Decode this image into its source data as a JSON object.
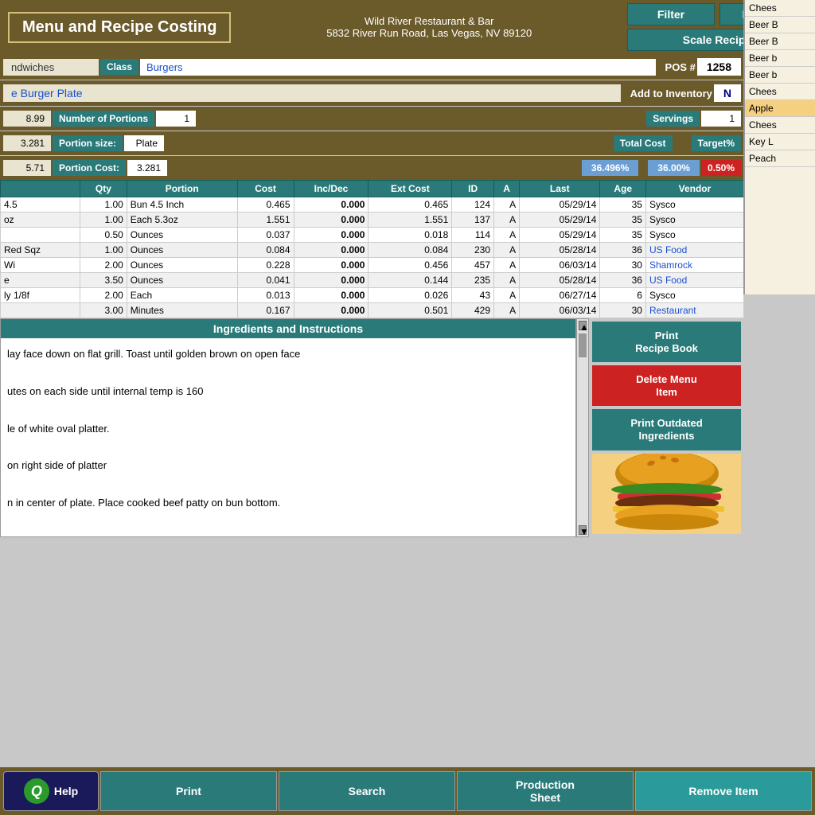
{
  "header": {
    "title": "Menu  and  Recipe  Costing",
    "restaurant_name": "Wild River Restaurant & Bar",
    "address": "5832 River Run Road, Las Vegas, NV 89120",
    "filter_label": "Filter",
    "release_label": "Release",
    "scale_recipe_label": "Scale Recipe"
  },
  "sidebar_items": [
    {
      "label": "Chees",
      "highlighted": false
    },
    {
      "label": "Beer B",
      "highlighted": false
    },
    {
      "label": "Beer B",
      "highlighted": false
    },
    {
      "label": "Beer b",
      "highlighted": false
    },
    {
      "label": "Beer b",
      "highlighted": false
    },
    {
      "label": "Chees",
      "highlighted": false
    },
    {
      "label": "Apple",
      "highlighted": true
    },
    {
      "label": "Chees",
      "highlighted": false
    },
    {
      "label": "Key L",
      "highlighted": false
    },
    {
      "label": "Peach",
      "highlighted": false
    }
  ],
  "form": {
    "category": "ndwiches",
    "class_label": "Class",
    "class_value": "Burgers",
    "pos_label": "POS #",
    "pos_value": "1258",
    "item_name": "e Burger Plate",
    "add_inventory_label": "Add to Inventory",
    "inventory_value": "N",
    "price": "8.99",
    "portions_label": "Number of Portions",
    "portions_value": "1",
    "servings_label": "Servings",
    "servings_value": "1",
    "portion_val_left": "3.281",
    "portion_size_label": "Portion size:",
    "portion_size_value": "Plate",
    "total_cost_label": "Total Cost",
    "target_label": "Target%",
    "price_left": "5.71",
    "portion_cost_label": "Portion Cost:",
    "portion_cost_value": "3.281",
    "total_cost_pct": "36.496%",
    "target_pct": "36.00%",
    "variance_pct": "0.50%"
  },
  "table": {
    "columns": [
      "Qty",
      "Portion",
      "Cost",
      "Inc/Dec",
      "Ext Cost",
      "ID",
      "A",
      "Last",
      "Age",
      "Vendor"
    ],
    "rows": [
      {
        "name": "4.5",
        "qty": "1.00",
        "portion": "Bun 4.5 Inch",
        "cost": "0.465",
        "incdec": "0.000",
        "extcost": "0.465",
        "id": "124",
        "a": "A",
        "last": "05/29/14",
        "age": "35",
        "vendor": "Sysco"
      },
      {
        "name": "oz",
        "qty": "1.00",
        "portion": "Each 5.3oz",
        "cost": "1.551",
        "incdec": "0.000",
        "extcost": "1.551",
        "id": "137",
        "a": "A",
        "last": "05/29/14",
        "age": "35",
        "vendor": "Sysco"
      },
      {
        "name": "",
        "qty": "0.50",
        "portion": "Ounces",
        "cost": "0.037",
        "incdec": "0.000",
        "extcost": "0.018",
        "id": "114",
        "a": "A",
        "last": "05/29/14",
        "age": "35",
        "vendor": "Sysco"
      },
      {
        "name": "Red Sqz",
        "qty": "1.00",
        "portion": "Ounces",
        "cost": "0.084",
        "incdec": "0.000",
        "extcost": "0.084",
        "id": "230",
        "a": "A",
        "last": "05/28/14",
        "age": "36",
        "vendor": "US Food"
      },
      {
        "name": "Wi",
        "qty": "2.00",
        "portion": "Ounces",
        "cost": "0.228",
        "incdec": "0.000",
        "extcost": "0.456",
        "id": "457",
        "a": "A",
        "last": "06/03/14",
        "age": "30",
        "vendor": "Shamrock"
      },
      {
        "name": "e",
        "qty": "3.50",
        "portion": "Ounces",
        "cost": "0.041",
        "incdec": "0.000",
        "extcost": "0.144",
        "id": "235",
        "a": "A",
        "last": "05/28/14",
        "age": "36",
        "vendor": "US Food"
      },
      {
        "name": "ly 1/8f",
        "qty": "2.00",
        "portion": "Each",
        "cost": "0.013",
        "incdec": "0.000",
        "extcost": "0.026",
        "id": "43",
        "a": "A",
        "last": "06/27/14",
        "age": "6",
        "vendor": "Sysco"
      },
      {
        "name": "",
        "qty": "3.00",
        "portion": "Minutes",
        "cost": "0.167",
        "incdec": "0.000",
        "extcost": "0.501",
        "id": "429",
        "a": "A",
        "last": "06/03/14",
        "age": "30",
        "vendor": "Restaurant"
      }
    ]
  },
  "ingredients": {
    "header": "Ingredients and Instructions",
    "lines": [
      "lay face down on flat grill. Toast until golden brown on open face",
      "",
      "utes on each side until internal temp is 160",
      "",
      "le of white oval platter.",
      "",
      "on right side of platter",
      "",
      "n in center of plate. Place cooked beef patty on bun bottom."
    ]
  },
  "action_buttons": {
    "print_recipe": "Print\nRecipe Book",
    "delete_menu": "Delete  Menu\nItem",
    "print_outdated": "Print Outdated\nIngredients"
  },
  "bottom_bar": {
    "help_label": "Help",
    "print_label": "Print",
    "search_label": "Search",
    "production_label": "Production\nSheet",
    "remove_label": "Remove Item"
  }
}
